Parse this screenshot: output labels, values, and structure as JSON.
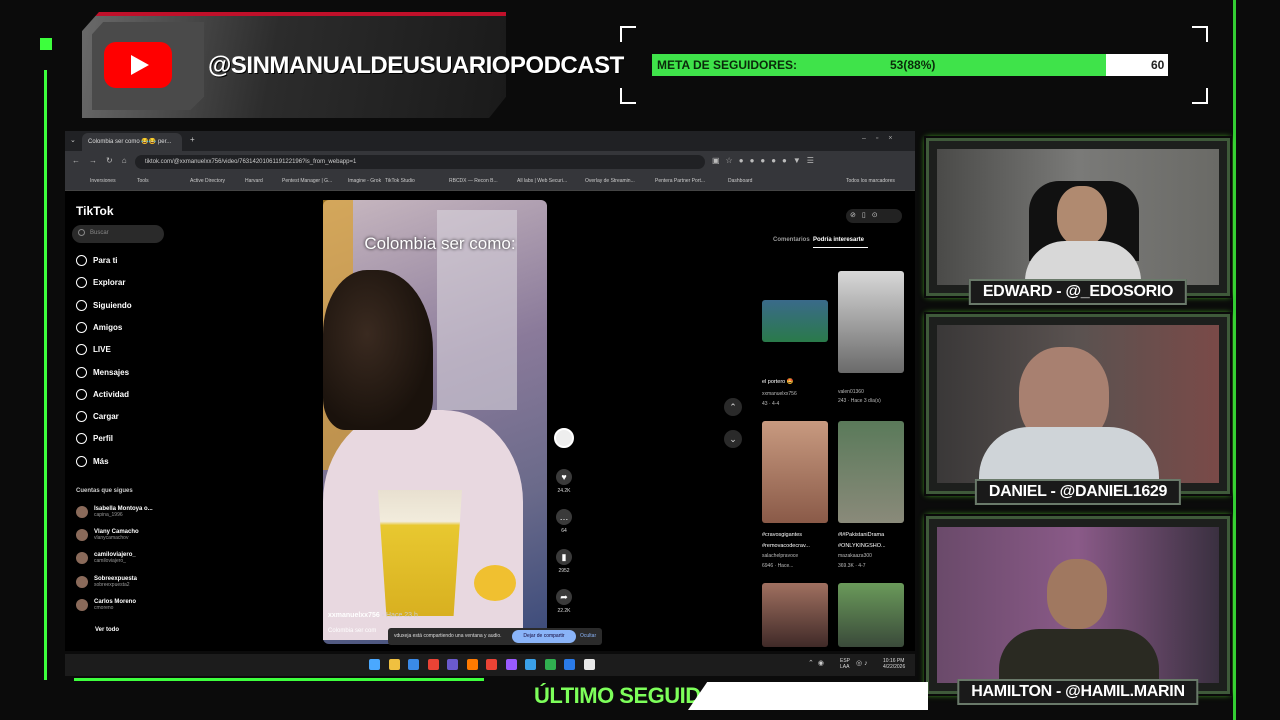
{
  "overlay": {
    "yt_handle": "@SINMANUALDEUSUARIOPODCAST",
    "goal": {
      "label": "META DE SEGUIDORES:",
      "progress_text": "53(88%)",
      "target": "60",
      "progress_fraction": 0.88
    },
    "last_follower_label": "ÚLTIMO SEGUIDOR",
    "cams": [
      {
        "label": "EDWARD - @_EDOSORIO"
      },
      {
        "label": "DANIEL - @DANIEL1629"
      },
      {
        "label": "HAMILTON - @HAMIL.MARIN"
      }
    ],
    "colors": {
      "accent": "#3dff3d",
      "youtube_red": "#ff0000"
    }
  },
  "browser": {
    "tab_title": "Colombia ser como 😂😂 per...",
    "url": "tiktok.com/@xxmanuelxx756/video/7631420106119122196?is_from_webapp=1",
    "bookmarks": [
      "Inversiones",
      "Tools",
      "",
      "Active Directory",
      "Harvard",
      "Pentest Manager | G...",
      "Imagine - Grok",
      "TikTok Studio",
      "RBCDX — Recon B...",
      "All labs | Web Securi...",
      "Overlay de Streamin...",
      "Pentera Partner Port...",
      "Dashboard",
      "Todos los marcadores"
    ]
  },
  "tiktok": {
    "logo": "TikTok",
    "search_placeholder": "Buscar",
    "nav": [
      "Para ti",
      "Explorar",
      "Siguiendo",
      "Amigos",
      "LIVE",
      "Mensajes",
      "Actividad",
      "Cargar",
      "Perfil",
      "Más"
    ],
    "following_title": "Cuentas que sigues",
    "following": [
      {
        "name": "Isabella Montoya o...",
        "handle": "capina_1996"
      },
      {
        "name": "Vlany Camacho",
        "handle": "vlanycamachov"
      },
      {
        "name": "camiloviajero_",
        "handle": "camiloviajero_"
      },
      {
        "name": "Sobreexpuesta",
        "handle": "sobreexpuesta2"
      },
      {
        "name": "Carlos Moreno",
        "handle": "cmoreno"
      }
    ],
    "see_all": "Ver todo",
    "video": {
      "caption_overlay": "Colombia ser como:",
      "author": "xxmanuelxx756",
      "time": "· Hace 23 h",
      "description": "Colombia ser com"
    },
    "actions": [
      {
        "icon": "like-icon",
        "count": "24.2K"
      },
      {
        "icon": "comment-icon",
        "count": "64"
      },
      {
        "icon": "bookmark-icon",
        "count": "2952"
      },
      {
        "icon": "share-icon",
        "count": "22.2K"
      }
    ],
    "share_notice": {
      "text": "vduxeja está compartiendo una ventana y audio.",
      "stop": "Dejar de compartir",
      "hide": "Ocultar"
    },
    "right_tabs": [
      "Comentarios",
      "Podría interesarte"
    ],
    "suggestions": [
      {
        "caption": "el portero 🤩",
        "author": "xxmanuelxx756",
        "stats": "43 · 4-4"
      },
      {
        "caption": "",
        "author": "valen01360",
        "stats": "243 · Hace 3 día(s)"
      },
      {
        "caption": "#cravosgigantes #removacodecrav...",
        "author": "salachelpravoce",
        "stats": "6946 · Hace..."
      },
      {
        "caption": "#l#PakistaniDrama #ONLYKINGSHO...",
        "author": "mazakaaza300",
        "stats": "369.3K · 4-7"
      }
    ]
  },
  "taskbar": {
    "lang": "ESP",
    "lang2": "LAA",
    "time": "10:16 PM",
    "date": "4/22/2026"
  }
}
